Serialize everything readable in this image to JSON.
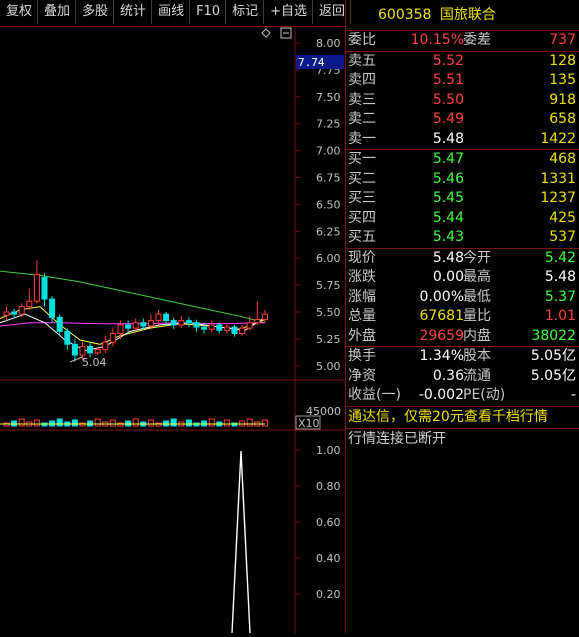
{
  "toolbar": {
    "buttons": [
      "复权",
      "叠加",
      "多股",
      "统计",
      "画线",
      "F10",
      "标记",
      "+自选",
      "返回"
    ]
  },
  "price_axis": {
    "labels": [
      "8.00",
      "7.75",
      "7.50",
      "7.25",
      "7.00",
      "6.75",
      "6.50",
      "6.25",
      "6.00",
      "5.75",
      "5.50",
      "5.25",
      "5.00"
    ],
    "current_price_tag": "7.74",
    "low_marker": "5.04",
    "volume_label": "45000",
    "volume_unit": "X10"
  },
  "indicator_axis": {
    "labels": [
      "1.00",
      "0.80",
      "0.60",
      "0.40",
      "0.20"
    ]
  },
  "colors": {
    "up": "#ff3c3c",
    "down": "#00e0e0",
    "ma_yellow": "#ffff40",
    "ma_magenta": "#ff40ff",
    "ma_green": "#40d040",
    "frame": "#7a1010"
  },
  "chart_data": {
    "type": "candlestick",
    "price_ylim": [
      5.0,
      8.0
    ],
    "indicator_ylim": [
      0,
      1.0
    ],
    "low_label": "5.04",
    "indicator_peak": 1.0
  },
  "quote": {
    "code": "600358",
    "name": "国旅联合",
    "ratio": {
      "label": "委比",
      "value": "10.15%",
      "label2": "委差",
      "value2": "737"
    },
    "asks": [
      {
        "label": "卖五",
        "price": "5.52",
        "volume": "128"
      },
      {
        "label": "卖四",
        "price": "5.51",
        "volume": "135"
      },
      {
        "label": "卖三",
        "price": "5.50",
        "volume": "918"
      },
      {
        "label": "卖二",
        "price": "5.49",
        "volume": "658"
      },
      {
        "label": "卖一",
        "price": "5.48",
        "volume": "1422"
      }
    ],
    "bids": [
      {
        "label": "买一",
        "price": "5.47",
        "volume": "468"
      },
      {
        "label": "买二",
        "price": "5.46",
        "volume": "1331"
      },
      {
        "label": "买三",
        "price": "5.45",
        "volume": "1237"
      },
      {
        "label": "买四",
        "price": "5.44",
        "volume": "425"
      },
      {
        "label": "买五",
        "price": "5.43",
        "volume": "537"
      }
    ],
    "stats": [
      {
        "l1": "现价",
        "v1": "5.48",
        "c1": "white",
        "l2": "今开",
        "v2": "5.42",
        "c2": "green"
      },
      {
        "l1": "涨跌",
        "v1": "0.00",
        "c1": "white",
        "l2": "最高",
        "v2": "5.48",
        "c2": "white"
      },
      {
        "l1": "涨幅",
        "v1": "0.00%",
        "c1": "white",
        "l2": "最低",
        "v2": "5.37",
        "c2": "green"
      },
      {
        "l1": "总量",
        "v1": "67681",
        "c1": "yellow",
        "l2": "量比",
        "v2": "1.01",
        "c2": "red"
      },
      {
        "l1": "外盘",
        "v1": "29659",
        "c1": "red",
        "l2": "内盘",
        "v2": "38022",
        "c2": "green"
      }
    ],
    "stats2": [
      {
        "l1": "换手",
        "v1": "1.34%",
        "l2": "股本",
        "v2": "5.05亿"
      },
      {
        "l1": "净资",
        "v1": "0.36",
        "l2": "流通",
        "v2": "5.05亿"
      },
      {
        "l1": "收益(一)",
        "v1": "-0.002",
        "l2": "PE(动)",
        "v2": "-"
      }
    ],
    "notice": "通达信，仅需20元查看千档行情",
    "status": "行情连接已断开"
  }
}
